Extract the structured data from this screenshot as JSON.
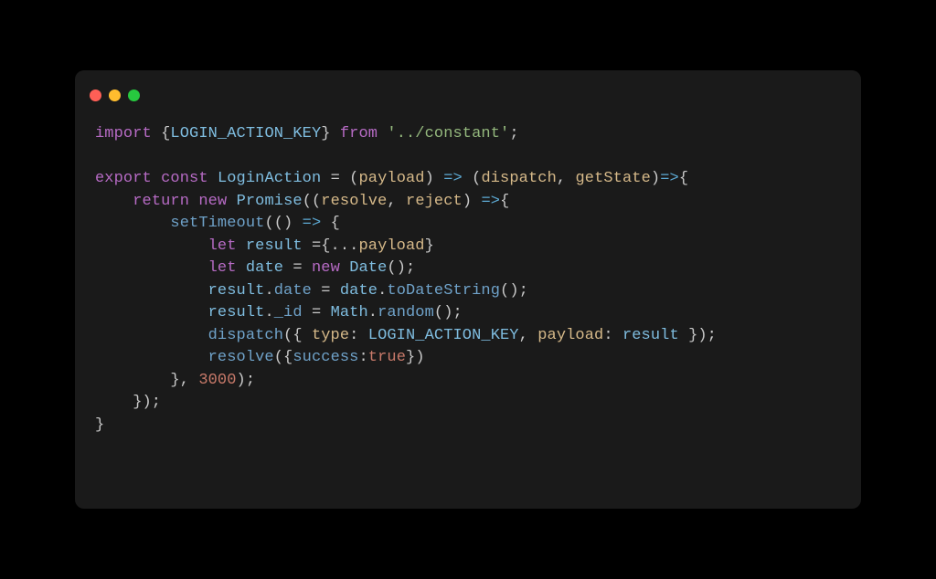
{
  "window": {
    "dots": [
      "red",
      "yellow",
      "green"
    ]
  },
  "code": {
    "lines": [
      [
        {
          "c": "kw",
          "t": "import"
        },
        {
          "t": " {"
        },
        {
          "c": "ident",
          "t": "LOGIN_ACTION_KEY"
        },
        {
          "t": "} "
        },
        {
          "c": "kw",
          "t": "from"
        },
        {
          "t": " "
        },
        {
          "c": "str",
          "t": "'../constant'"
        },
        {
          "t": ";"
        }
      ],
      [],
      [
        {
          "c": "kw",
          "t": "export"
        },
        {
          "t": " "
        },
        {
          "c": "kw",
          "t": "const"
        },
        {
          "t": " "
        },
        {
          "c": "ident",
          "t": "LoginAction"
        },
        {
          "t": " = ("
        },
        {
          "c": "param",
          "t": "payload"
        },
        {
          "t": ") "
        },
        {
          "c": "op",
          "t": "=>"
        },
        {
          "t": " ("
        },
        {
          "c": "param",
          "t": "dispatch"
        },
        {
          "t": ", "
        },
        {
          "c": "param",
          "t": "getState"
        },
        {
          "t": ")"
        },
        {
          "c": "op",
          "t": "=>"
        },
        {
          "t": "{"
        }
      ],
      [
        {
          "t": "    "
        },
        {
          "c": "kw",
          "t": "return"
        },
        {
          "t": " "
        },
        {
          "c": "kw",
          "t": "new"
        },
        {
          "t": " "
        },
        {
          "c": "ident",
          "t": "Promise"
        },
        {
          "t": "(("
        },
        {
          "c": "param",
          "t": "resolve"
        },
        {
          "t": ", "
        },
        {
          "c": "param",
          "t": "reject"
        },
        {
          "t": ") "
        },
        {
          "c": "op",
          "t": "=>"
        },
        {
          "t": "{"
        }
      ],
      [
        {
          "t": "        "
        },
        {
          "c": "fn",
          "t": "setTimeout"
        },
        {
          "t": "(() "
        },
        {
          "c": "op",
          "t": "=>"
        },
        {
          "t": " {"
        }
      ],
      [
        {
          "t": "            "
        },
        {
          "c": "kw",
          "t": "let"
        },
        {
          "t": " "
        },
        {
          "c": "ident",
          "t": "result"
        },
        {
          "t": " ={..."
        },
        {
          "c": "param",
          "t": "payload"
        },
        {
          "t": "}"
        }
      ],
      [
        {
          "t": "            "
        },
        {
          "c": "kw",
          "t": "let"
        },
        {
          "t": " "
        },
        {
          "c": "ident",
          "t": "date"
        },
        {
          "t": " = "
        },
        {
          "c": "kw",
          "t": "new"
        },
        {
          "t": " "
        },
        {
          "c": "ident",
          "t": "Date"
        },
        {
          "t": "();"
        }
      ],
      [
        {
          "t": "            "
        },
        {
          "c": "ident",
          "t": "result"
        },
        {
          "t": "."
        },
        {
          "c": "fn",
          "t": "date"
        },
        {
          "t": " = "
        },
        {
          "c": "ident",
          "t": "date"
        },
        {
          "t": "."
        },
        {
          "c": "fn",
          "t": "toDateString"
        },
        {
          "t": "();"
        }
      ],
      [
        {
          "t": "            "
        },
        {
          "c": "ident",
          "t": "result"
        },
        {
          "t": "."
        },
        {
          "c": "fn",
          "t": "_id"
        },
        {
          "t": " = "
        },
        {
          "c": "ident",
          "t": "Math"
        },
        {
          "t": "."
        },
        {
          "c": "fn",
          "t": "random"
        },
        {
          "t": "();"
        }
      ],
      [
        {
          "t": "            "
        },
        {
          "c": "fn",
          "t": "dispatch"
        },
        {
          "t": "({ "
        },
        {
          "c": "param",
          "t": "type"
        },
        {
          "t": ": "
        },
        {
          "c": "ident",
          "t": "LOGIN_ACTION_KEY"
        },
        {
          "t": ", "
        },
        {
          "c": "param",
          "t": "payload"
        },
        {
          "t": ": "
        },
        {
          "c": "ident",
          "t": "result"
        },
        {
          "t": " });"
        }
      ],
      [
        {
          "t": "            "
        },
        {
          "c": "fn",
          "t": "resolve"
        },
        {
          "t": "({"
        },
        {
          "c": "fn",
          "t": "success"
        },
        {
          "t": ":"
        },
        {
          "c": "num",
          "t": "true"
        },
        {
          "t": "})"
        }
      ],
      [
        {
          "t": "        }, "
        },
        {
          "c": "num",
          "t": "3000"
        },
        {
          "t": ");"
        }
      ],
      [
        {
          "t": "    });"
        }
      ],
      [
        {
          "t": "}"
        }
      ]
    ]
  }
}
